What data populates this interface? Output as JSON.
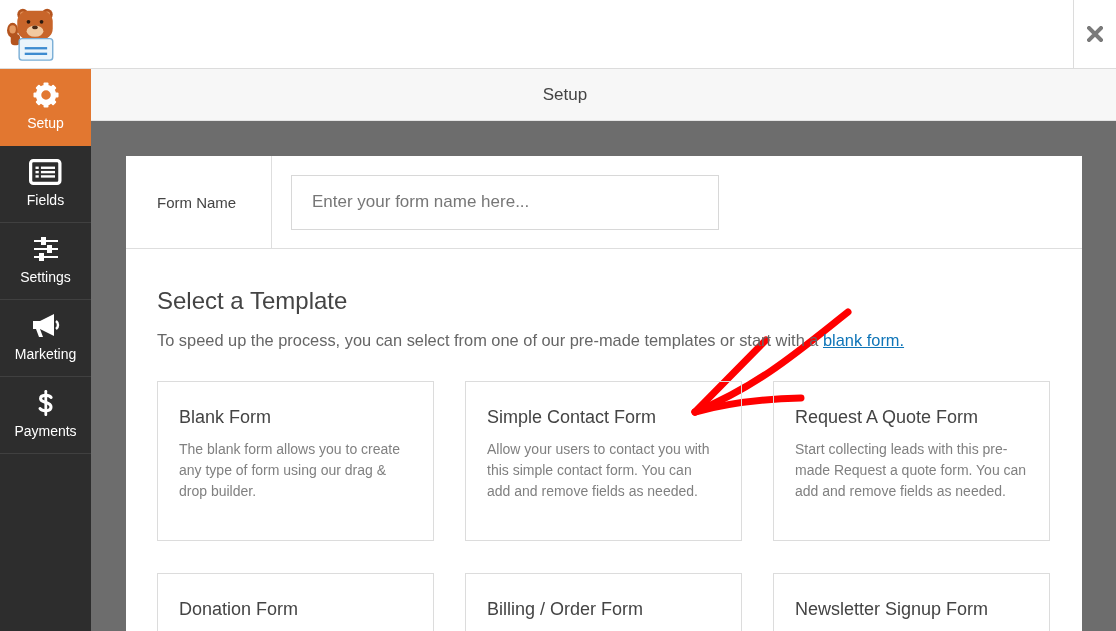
{
  "sidebar": {
    "items": [
      {
        "label": "Setup",
        "selected": true
      },
      {
        "label": "Fields",
        "selected": false
      },
      {
        "label": "Settings",
        "selected": false
      },
      {
        "label": "Marketing",
        "selected": false
      },
      {
        "label": "Payments",
        "selected": false
      }
    ]
  },
  "title_bar": {
    "title": "Setup"
  },
  "form_name": {
    "label": "Form Name",
    "placeholder": "Enter your form name here..."
  },
  "templates": {
    "heading": "Select a Template",
    "intro": "To speed up the process, you can select from one of our pre-made templates or start with a",
    "link": "blank form.",
    "items": [
      {
        "title": "Blank Form",
        "description": "The blank form allows you to create any type of form using our drag & drop builder."
      },
      {
        "title": "Simple Contact Form",
        "description": "Allow your users to contact you with this simple contact form. You can add and remove fields as needed."
      },
      {
        "title": "Request A Quote Form",
        "description": "Start collecting leads with this pre-made Request a quote form. You can add and remove fields as needed."
      },
      {
        "title": "Donation Form"
      },
      {
        "title": "Billing / Order Form"
      },
      {
        "title": "Newsletter Signup Form"
      }
    ]
  }
}
